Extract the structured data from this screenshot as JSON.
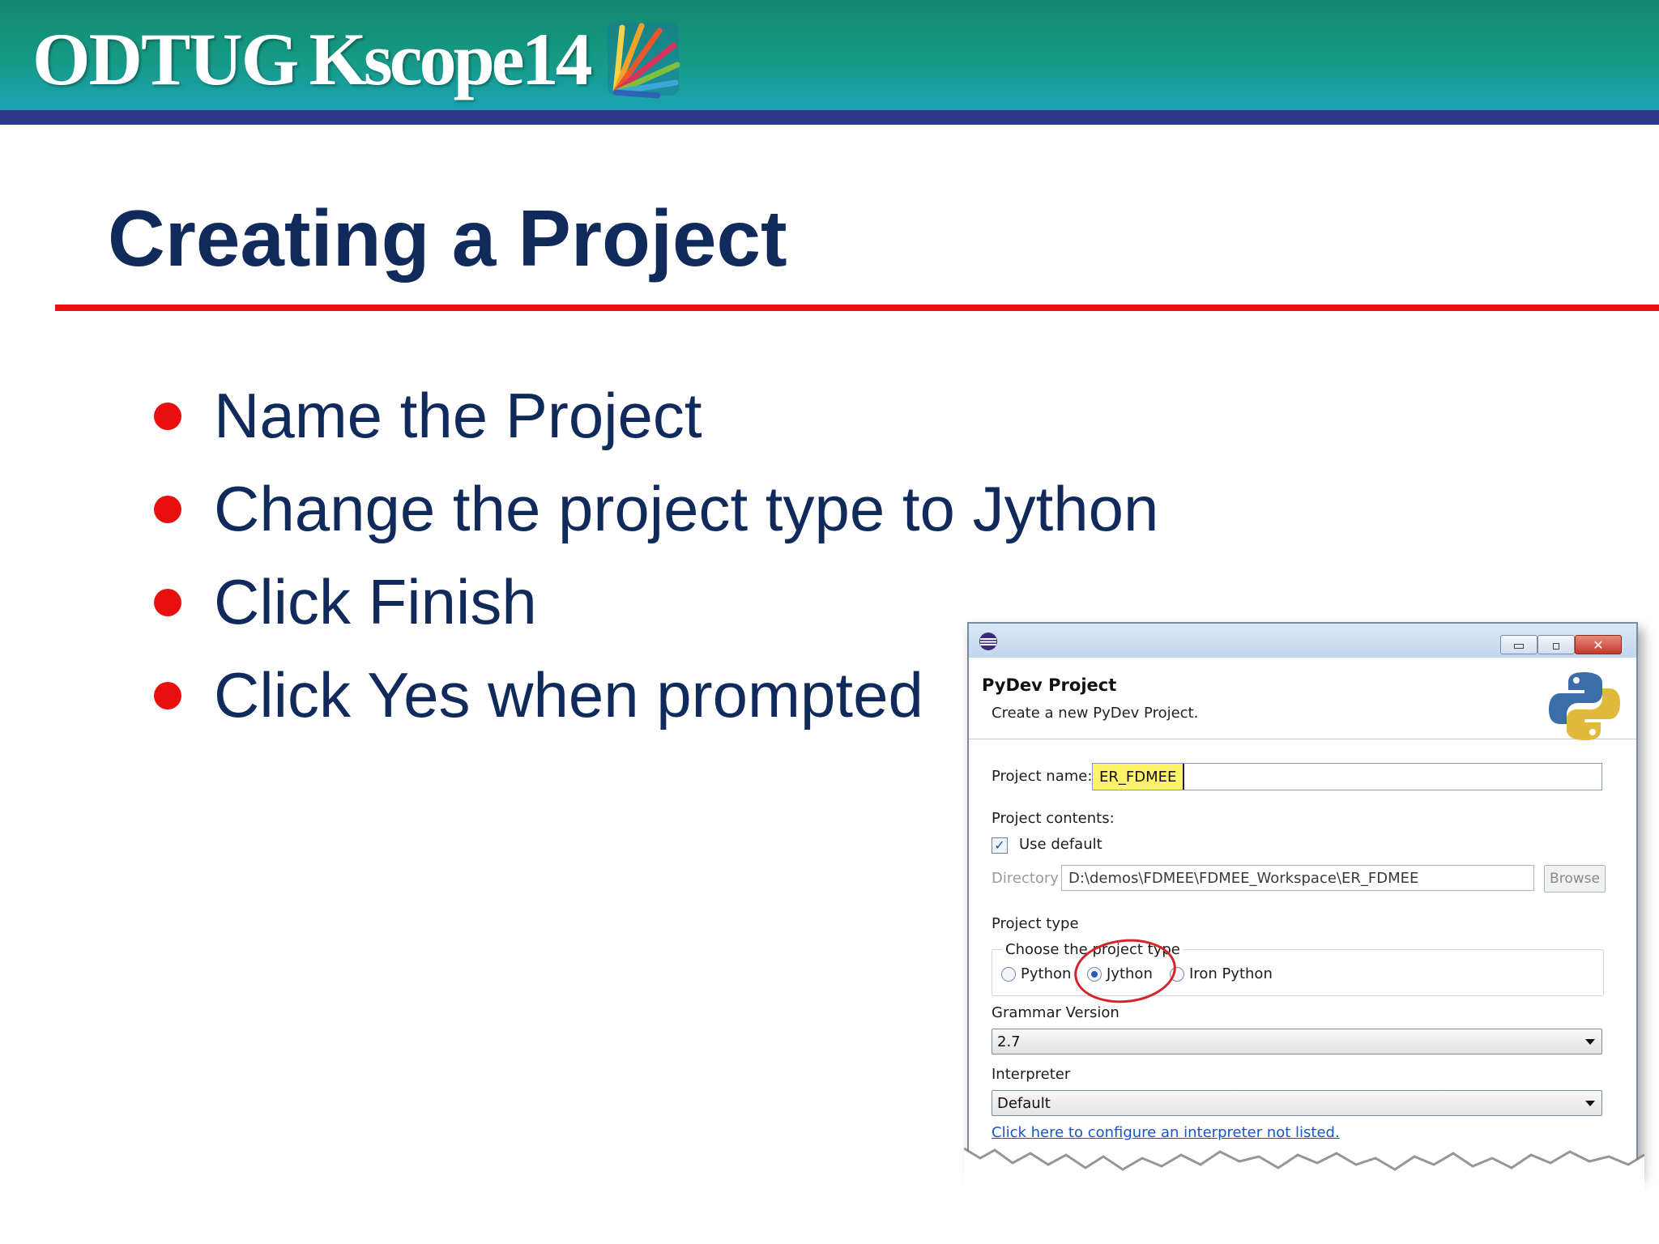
{
  "banner": {
    "org": "ODTUG",
    "event": "Kscope14"
  },
  "slide": {
    "title": "Creating a Project",
    "bullets": [
      "Name the Project",
      "Change the project type to Jython",
      "Click Finish",
      "Click Yes when prompted"
    ]
  },
  "colors": {
    "title": "#102a5c",
    "accent_red": "#e8100f",
    "banner_teal": "#169a86",
    "banner_bar": "#2b3a8c"
  },
  "dialog": {
    "title": "PyDev Project",
    "subtitle": "Create a new PyDev Project.",
    "window_buttons": {
      "minimize": "▭",
      "maximize": "▫",
      "close": "✕"
    },
    "project_name_label": "Project name:",
    "project_name_value": "ER_FDMEE",
    "project_contents_label": "Project contents:",
    "use_default_label": "Use default",
    "use_default_checked": true,
    "directory_label": "Directory",
    "directory_value": "D:\\demos\\FDMEE\\FDMEE_Workspace\\ER_FDMEE",
    "browse_label": "Browse",
    "project_type_label": "Project type",
    "choose_type_label": "Choose the project type",
    "project_types": [
      "Python",
      "Jython",
      "Iron Python"
    ],
    "selected_type": "Jython",
    "grammar_label": "Grammar Version",
    "grammar_value": "2.7",
    "interpreter_label": "Interpreter",
    "interpreter_value": "Default",
    "configure_link": "Click here to configure an interpreter not listed."
  }
}
